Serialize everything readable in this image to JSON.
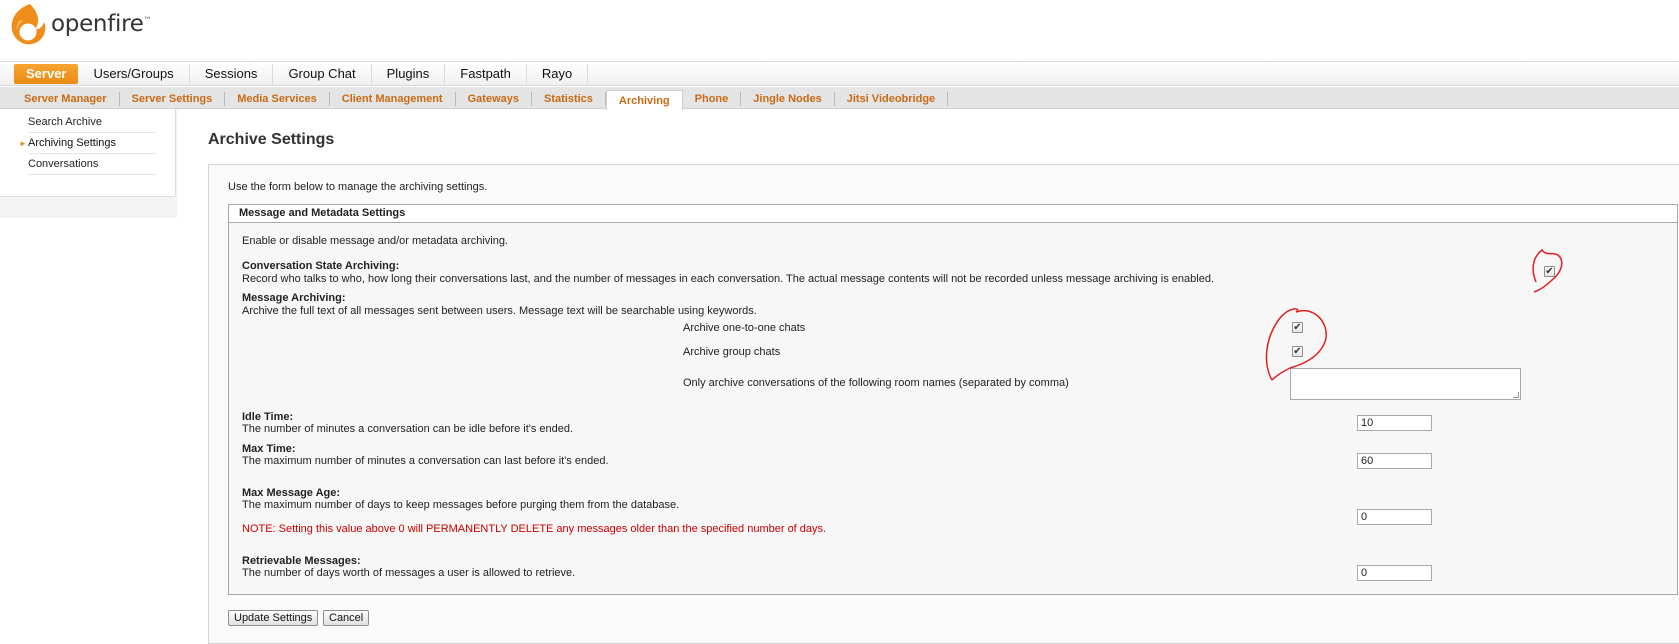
{
  "brand": {
    "name": "openfire",
    "tm": "™"
  },
  "main_nav": [
    {
      "label": "Server",
      "active": true
    },
    {
      "label": "Users/Groups"
    },
    {
      "label": "Sessions"
    },
    {
      "label": "Group Chat"
    },
    {
      "label": "Plugins"
    },
    {
      "label": "Fastpath"
    },
    {
      "label": "Rayo"
    }
  ],
  "sub_nav": [
    {
      "label": "Server Manager"
    },
    {
      "label": "Server Settings"
    },
    {
      "label": "Media Services"
    },
    {
      "label": "Client Management"
    },
    {
      "label": "Gateways"
    },
    {
      "label": "Statistics"
    },
    {
      "label": "Archiving",
      "active": true
    },
    {
      "label": "Phone"
    },
    {
      "label": "Jingle Nodes"
    },
    {
      "label": "Jitsi Videobridge"
    }
  ],
  "sidebar": {
    "items": [
      {
        "label": "Search Archive"
      },
      {
        "label": "Archiving Settings",
        "active": true
      },
      {
        "label": "Conversations"
      }
    ]
  },
  "page": {
    "title": "Archive Settings",
    "intro": "Use the form below to manage the archiving settings."
  },
  "section": {
    "legend": "Message and Metadata Settings",
    "intro": "Enable or disable message and/or metadata archiving.",
    "conversation_state": {
      "label": "Conversation State Archiving:",
      "desc": "Record who talks to who, how long their conversations last, and the number of messages in each conversation. The actual message contents will not be recorded unless message archiving is enabled.",
      "checked": true
    },
    "message_archiving": {
      "label": "Message Archiving:",
      "desc": "Archive the full text of all messages sent between users. Message text will be searchable using keywords.",
      "one_to_one_label": "Archive one-to-one chats",
      "one_to_one_checked": true,
      "group_label": "Archive group chats",
      "group_checked": true,
      "rooms_label": "Only archive conversations of the following room names (separated by comma)",
      "rooms_value": ""
    },
    "idle_time": {
      "label": "Idle Time:",
      "desc": "The number of minutes a conversation can be idle before it's ended.",
      "value": "10"
    },
    "max_time": {
      "label": "Max Time:",
      "desc": "The maximum number of minutes a conversation can last before it's ended.",
      "value": "60"
    },
    "max_message_age": {
      "label": "Max Message Age:",
      "desc": "The maximum number of days to keep messages before purging them from the database.",
      "note": "NOTE: Setting this value above 0 will PERMANENTLY DELETE any messages older than the specified number of days.",
      "value": "0"
    },
    "retrievable": {
      "label": "Retrievable Messages:",
      "desc": "The number of days worth of messages a user is allowed to retrieve.",
      "value": "0"
    }
  },
  "buttons": {
    "update": "Update Settings",
    "cancel": "Cancel"
  },
  "colors": {
    "accent": "#e78c14",
    "subnav_text": "#c96a14",
    "warning": "#cc0000",
    "annotation": "#e02020"
  }
}
